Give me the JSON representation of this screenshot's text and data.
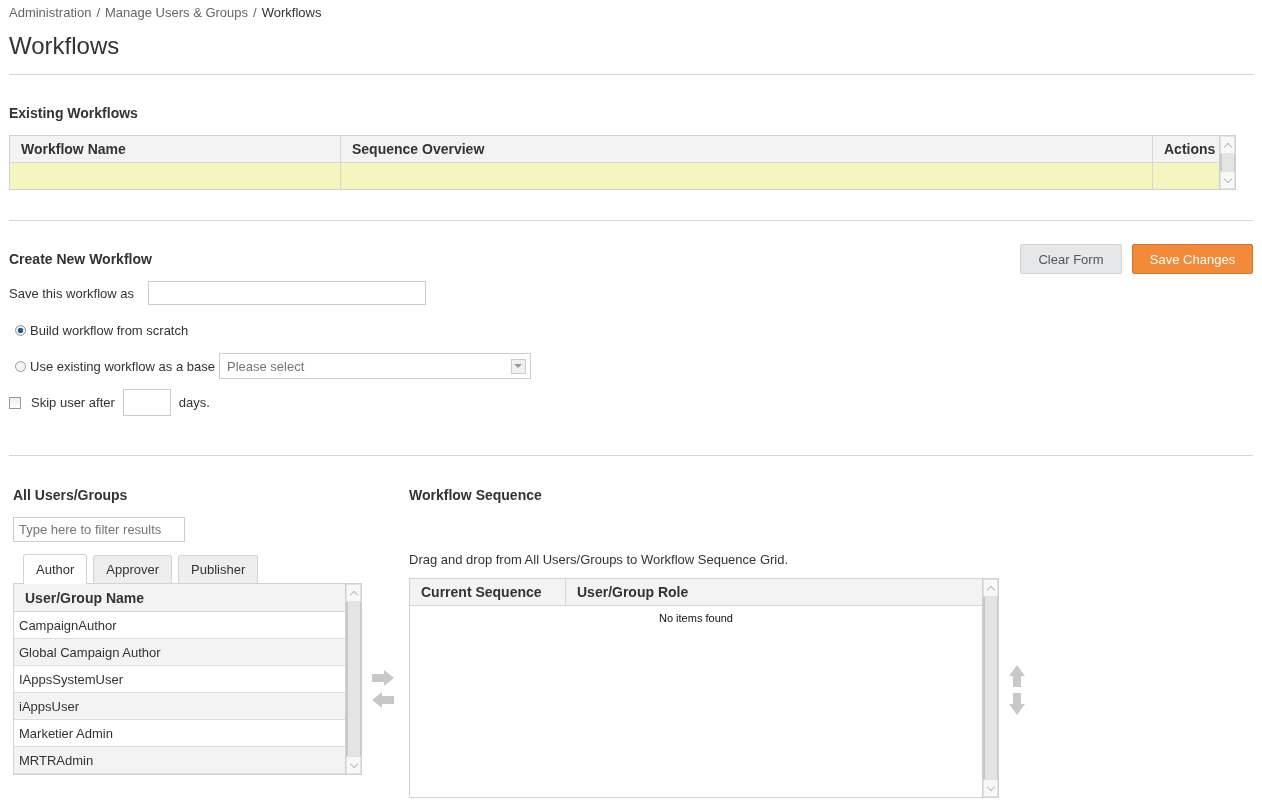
{
  "breadcrumb_separator": "/",
  "breadcrumb": [
    {
      "label": "Administration",
      "current": false
    },
    {
      "label": "Manage Users & Groups",
      "current": false
    },
    {
      "label": "Workflows",
      "current": true
    }
  ],
  "title": "Workflows",
  "existing": {
    "heading": "Existing Workflows",
    "columns": [
      "Workflow Name",
      "Sequence Overview",
      "Actions"
    ]
  },
  "create": {
    "heading": "Create New Workflow",
    "save_label": "Save this workflow as",
    "buttons": [
      {
        "label": "Clear Form",
        "kind": "secondary"
      },
      {
        "label": "Save Changes",
        "kind": "primary"
      }
    ],
    "options": [
      {
        "label": "Build workflow from scratch",
        "selected": true
      },
      {
        "label": "Use existing workflow as a base",
        "selected": false,
        "select_placeholder": "Please select"
      }
    ],
    "skip": {
      "label_before": "Skip user after",
      "label_after": "days.",
      "checked": false
    }
  },
  "users": {
    "heading": "All Users/Groups",
    "filter_placeholder": "Type here to filter results",
    "tabs": [
      {
        "label": "Author",
        "selected": true
      },
      {
        "label": "Approver",
        "selected": false
      },
      {
        "label": "Publisher",
        "selected": false
      }
    ],
    "column": "User/Group Name",
    "rows": [
      "CampaignAuthor",
      "Global Campaign Author",
      "IAppsSystemUser",
      "iAppsUser",
      "Marketier Admin",
      "MRTRAdmin"
    ]
  },
  "sequence": {
    "heading": "Workflow Sequence",
    "hint": "Drag and drop from All Users/Groups to Workflow Sequence Grid.",
    "columns": [
      "Current Sequence",
      "User/Group Role"
    ],
    "empty": "No items found"
  }
}
